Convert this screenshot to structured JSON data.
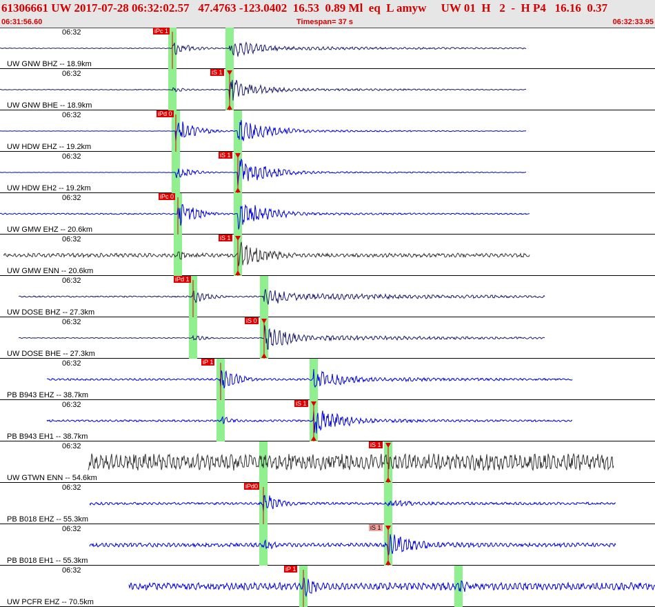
{
  "header": {
    "title": "61306661 UW 2017-07-28 06:32:02.57   47.4763 -123.0402  16.53  0.89 Ml  eq  L amyw     UW 01  H   2  -  H P4   16.16  0.37",
    "start_time": "06:31:56.60",
    "timespan": "Timespan=  37 s",
    "end_time": "06:32:33.95"
  },
  "colors": {
    "blue": "#0000e0",
    "navy": "#1a1a6e",
    "gray": "#333333",
    "pick_red": "#e00000",
    "window_green": "#90f090"
  },
  "panels": [
    {
      "label": "UW GNW BHZ -- 18.9km",
      "time": "06:32",
      "pick": "iPc 1",
      "pick_style": "dark",
      "color": "navy",
      "start": 0,
      "end": 763,
      "amp": 0.35,
      "p": 250,
      "s": 333,
      "ps": 0.65,
      "ss": 0.9,
      "noise": 0.03,
      "coda": 0.35
    },
    {
      "label": "UW GNW BHE -- 18.9km",
      "time": "06:32",
      "pick": "iS 1",
      "pick_style": "dark",
      "color": "navy",
      "start": 0,
      "end": 763,
      "amp": 0.35,
      "p": 250,
      "s": 333,
      "ps": 0.2,
      "ss": 0.95,
      "noise": 0.03,
      "coda": 0.25
    },
    {
      "label": "UW HDW EHZ -- 19.2km",
      "time": "06:32",
      "pick": "iPd 0",
      "pick_style": "dark",
      "color": "blue",
      "start": 0,
      "end": 763,
      "amp": 0.45,
      "p": 255,
      "s": 345,
      "ps": 0.95,
      "ss": 0.9,
      "noise": 0.01,
      "coda": 0.15
    },
    {
      "label": "UW HDW EH2 -- 19.2km",
      "time": "06:32",
      "pick": "iS 1",
      "pick_style": "dark",
      "color": "blue",
      "start": 0,
      "end": 763,
      "amp": 0.45,
      "p": 255,
      "s": 345,
      "ps": 0.4,
      "ss": 0.95,
      "noise": 0.01,
      "coda": 0.15
    },
    {
      "label": "UW GMW EHZ -- 20.6km",
      "time": "06:32",
      "pick": "iPc 0",
      "pick_style": "dark",
      "color": "blue",
      "start": 0,
      "end": 768,
      "amp": 0.45,
      "p": 258,
      "s": 345,
      "ps": 0.95,
      "ss": 0.95,
      "noise": 0.04,
      "coda": 0.2
    },
    {
      "label": "UW GMW ENN -- 20.6km",
      "time": "06:32",
      "pick": "iS 1",
      "pick_style": "dark",
      "color": "gray",
      "start": 5,
      "end": 768,
      "amp": 0.45,
      "p": 258,
      "s": 345,
      "ps": 0.3,
      "ss": 0.95,
      "noise": 0.12,
      "coda": 0.25
    },
    {
      "label": "UW DOSE BHZ -- 27.3km",
      "time": "06:32",
      "pick": "iPd 1",
      "pick_style": "dark",
      "color": "navy",
      "start": 27,
      "end": 790,
      "amp": 0.4,
      "p": 280,
      "s": 383,
      "ps": 0.5,
      "ss": 0.7,
      "noise": 0.05,
      "coda": 0.5
    },
    {
      "label": "UW DOSE BHE -- 27.3km",
      "time": "06:32",
      "pick": "iS 0",
      "pick_style": "dark",
      "color": "navy",
      "start": 27,
      "end": 790,
      "amp": 0.4,
      "p": 280,
      "s": 383,
      "ps": 0.2,
      "ss": 0.95,
      "noise": 0.03,
      "coda": 0.4
    },
    {
      "label": "PB B943 EHZ -- 38.7km",
      "time": "06:32",
      "pick": "iP 1",
      "pick_style": "dark",
      "color": "blue",
      "start": 68,
      "end": 830,
      "amp": 0.45,
      "p": 320,
      "s": 455,
      "ps": 0.8,
      "ss": 0.8,
      "noise": 0.06,
      "coda": 0.3
    },
    {
      "label": "PB B943 EH1 -- 38.7km",
      "time": "06:32",
      "pick": "iS 1",
      "pick_style": "dark",
      "color": "blue",
      "start": 68,
      "end": 830,
      "amp": 0.45,
      "p": 320,
      "s": 455,
      "ps": 0.3,
      "ss": 0.95,
      "noise": 0.06,
      "coda": 0.25
    },
    {
      "label": "UW GTWN ENN -- 54.6km",
      "time": "06:32",
      "pick": "iS 1",
      "pick_style": "dark",
      "color": "gray",
      "start": 128,
      "end": 890,
      "amp": 0.45,
      "p": 382,
      "s": 563,
      "ps": 0.4,
      "ss": 0.6,
      "noise": 0.5,
      "coda": 0.3
    },
    {
      "label": "PB B018 EHZ -- 55.3km",
      "time": "06:32",
      "pick": "iPd0",
      "pick_style": "dark",
      "color": "blue",
      "start": 130,
      "end": 893,
      "amp": 0.45,
      "p": 382,
      "s": 563,
      "ps": 0.75,
      "ss": 0.3,
      "noise": 0.08,
      "coda": 0.2
    },
    {
      "label": "PB B018 EH1 -- 55.3km",
      "time": "06:32",
      "pick": "iS 1",
      "pick_style": "light",
      "color": "blue",
      "start": 130,
      "end": 893,
      "amp": 0.45,
      "p": 382,
      "s": 563,
      "ps": 0.35,
      "ss": 0.75,
      "noise": 0.12,
      "coda": 0.35
    },
    {
      "label": "UW PCFR EHZ -- 70.5km",
      "time": "06:32",
      "pick": "iP 1",
      "pick_style": "dark",
      "color": "blue",
      "start": 187,
      "end": 950,
      "amp": 0.45,
      "p": 440,
      "s": 665,
      "ps": 0.8,
      "ss": 0.4,
      "noise": 0.22,
      "coda": 0.3
    }
  ]
}
